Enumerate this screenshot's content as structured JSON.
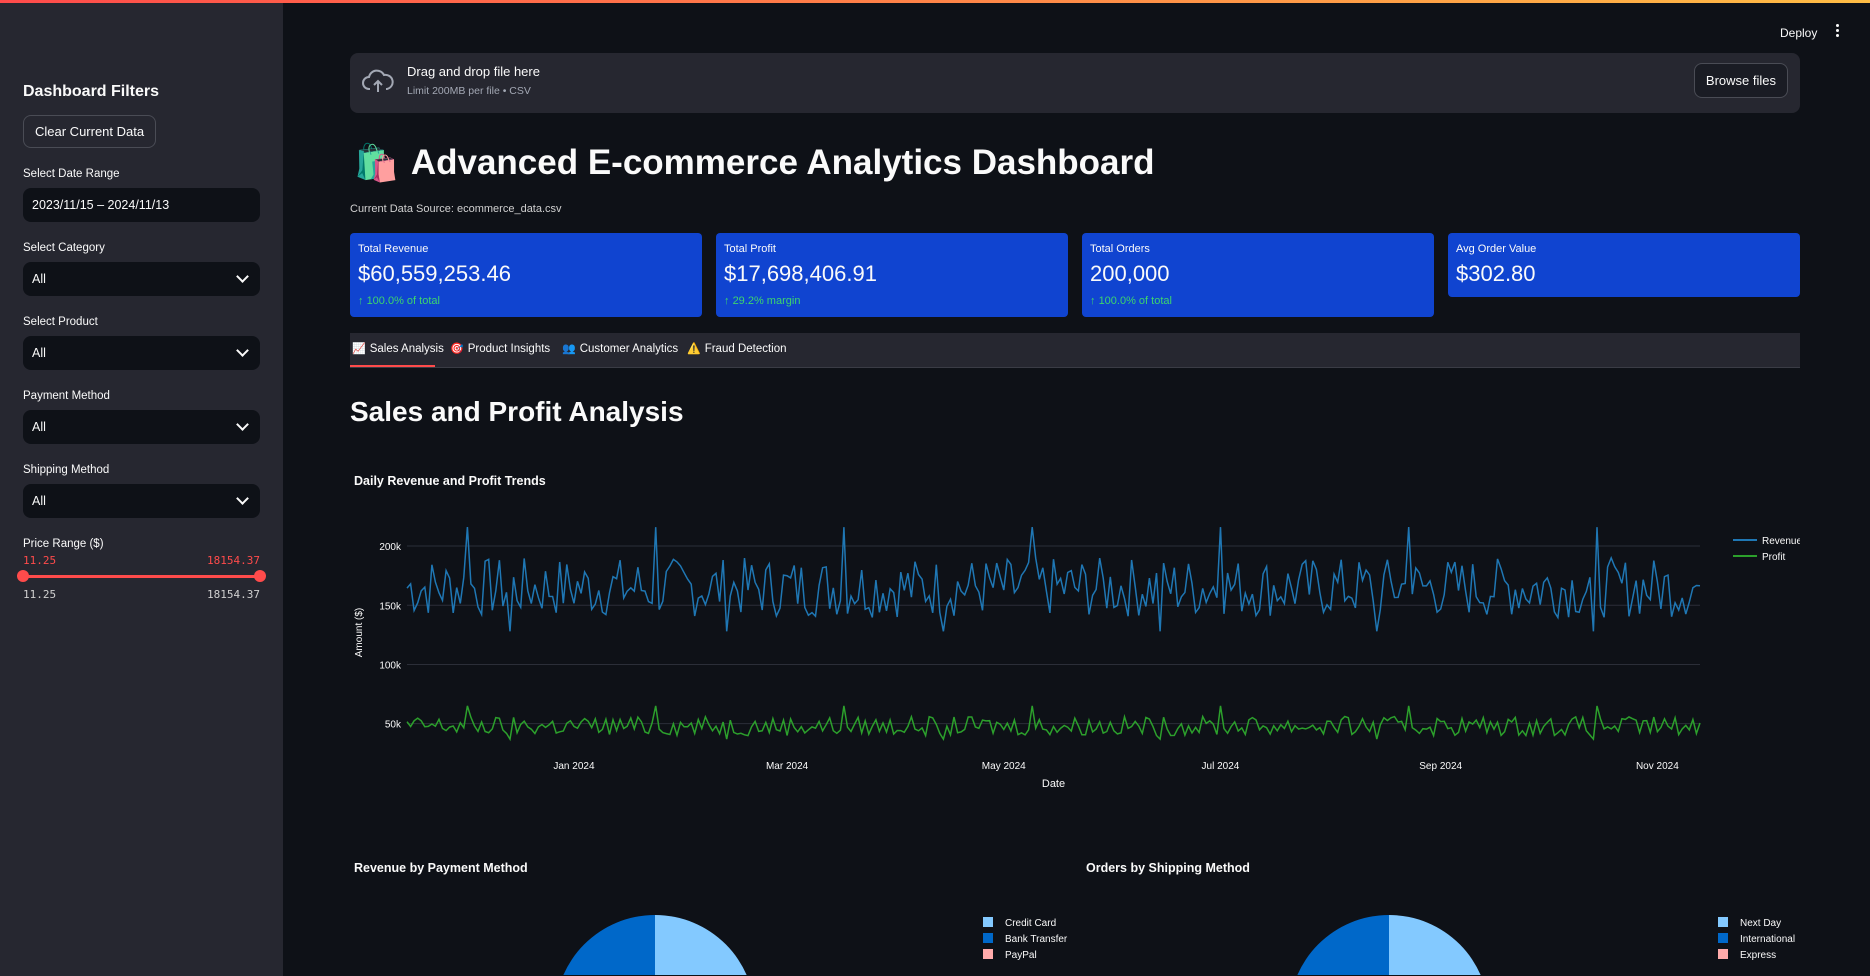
{
  "app": {
    "deploy_label": "Deploy"
  },
  "sidebar": {
    "title": "Dashboard Filters",
    "clear_button": "Clear Current Data",
    "date_range": {
      "label": "Select Date Range",
      "value": "2023/11/15 – 2024/11/13"
    },
    "category": {
      "label": "Select Category",
      "value": "All"
    },
    "product": {
      "label": "Select Product",
      "value": "All"
    },
    "payment": {
      "label": "Payment Method",
      "value": "All"
    },
    "shipping": {
      "label": "Shipping Method",
      "value": "All"
    },
    "price": {
      "label": "Price Range ($)",
      "low": "11.25",
      "high": "18154.37",
      "min": "11.25",
      "max": "18154.37"
    }
  },
  "uploader": {
    "title": "Drag and drop file here",
    "limit": "Limit 200MB per file • CSV",
    "browse": "Browse files"
  },
  "header": {
    "emoji": "🛍️",
    "title": "Advanced E-commerce Analytics Dashboard",
    "source": "Current Data Source: ecommerce_data.csv"
  },
  "metrics": [
    {
      "label": "Total Revenue",
      "value": "$60,559,253.46",
      "delta": "100.0% of total"
    },
    {
      "label": "Total Profit",
      "value": "$17,698,406.91",
      "delta": "29.2% margin"
    },
    {
      "label": "Total Orders",
      "value": "200,000",
      "delta": "100.0% of total"
    },
    {
      "label": "Avg Order Value",
      "value": "$302.80",
      "delta": ""
    }
  ],
  "tabs": [
    {
      "label": "Sales Analysis",
      "icon": "📈"
    },
    {
      "label": "Product Insights",
      "icon": "🎯"
    },
    {
      "label": "Customer Analytics",
      "icon": "👥"
    },
    {
      "label": "Fraud Detection",
      "icon": "⚠️"
    }
  ],
  "section_title": "Sales and Profit Analysis",
  "colors": {
    "revenue": "#1f77b4",
    "profit": "#2ca02c",
    "accent": "#ff4b4b",
    "metric_bg": "#1044d0"
  },
  "chart_data": [
    {
      "type": "line",
      "title": "Daily Revenue and Profit Trends",
      "xlabel": "Date",
      "ylabel": "Amount ($)",
      "xlim": [
        "2023-11-15",
        "2024-11-13"
      ],
      "ylim": [
        32000,
        222000
      ],
      "xticks": [
        "Jan 2024",
        "Mar 2024",
        "May 2024",
        "Jul 2024",
        "Sep 2024",
        "Nov 2024"
      ],
      "yticks": [
        "50k",
        "100k",
        "150k",
        "200k"
      ],
      "legend": "top-right",
      "series": [
        {
          "name": "Revenue",
          "mean": 165000,
          "min": 128000,
          "max": 216000
        },
        {
          "name": "Profit",
          "mean": 48000,
          "min": 37000,
          "max": 65000
        }
      ]
    },
    {
      "type": "pie",
      "title": "Revenue by Payment Method",
      "legend": [
        "Credit Card",
        "Bank Transfer",
        "PayPal"
      ],
      "colors": [
        "#83c9ff",
        "#0068c9",
        "#ffabab"
      ]
    },
    {
      "type": "pie",
      "title": "Orders by Shipping Method",
      "legend": [
        "Next Day",
        "International",
        "Express"
      ],
      "colors": [
        "#83c9ff",
        "#0068c9",
        "#ffabab"
      ]
    }
  ]
}
